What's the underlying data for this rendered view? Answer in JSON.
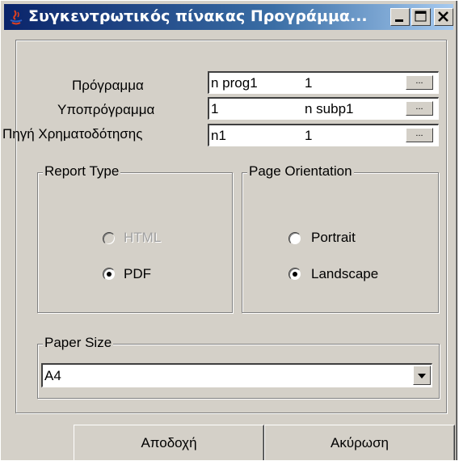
{
  "window": {
    "title": "Συγκεντρωτικός πίνακας Προγράμμα...",
    "controls": [
      "minimize-icon",
      "maximize-icon",
      "close-icon"
    ]
  },
  "fields": [
    {
      "label": "Πρόγραμμα",
      "value_code": "n prog1",
      "value_name": "1",
      "button": "..."
    },
    {
      "label": "Υποπρόγραμμα",
      "value_code": "1",
      "value_name": "n subp1",
      "button": "..."
    },
    {
      "label": "Πηγή Χρηματοδότησης",
      "value_code": "n1",
      "value_name": "1",
      "button": "..."
    }
  ],
  "report_type": {
    "legend": "Report Type",
    "options": [
      {
        "label": "HTML",
        "selected": false,
        "enabled": false
      },
      {
        "label": "PDF",
        "selected": true,
        "enabled": true
      }
    ]
  },
  "page_orientation": {
    "legend": "Page Orientation",
    "options": [
      {
        "label": "Portrait",
        "selected": false
      },
      {
        "label": "Landscape",
        "selected": true
      }
    ]
  },
  "paper_size": {
    "legend": "Paper Size",
    "selected": "A4"
  },
  "buttons": {
    "accept": "Αποδοχή",
    "cancel": "Ακύρωση"
  },
  "colors": {
    "title_start": "#0a246a",
    "title_end": "#a6caf0",
    "face": "#d4d0c8"
  }
}
